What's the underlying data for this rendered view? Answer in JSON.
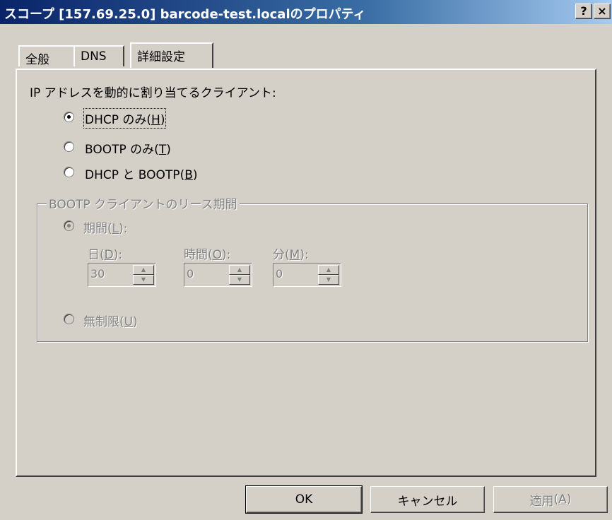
{
  "window": {
    "title": "スコープ [157.69.25.0] barcode-test.localのプロパティ",
    "help_button": "?",
    "close_button": "×"
  },
  "tabs": [
    {
      "label": "全般",
      "active": false
    },
    {
      "label": "DNS",
      "active": false
    },
    {
      "label": "詳細設定",
      "active": true
    }
  ],
  "section_label": "IP アドレスを動的に割り当てるクライアント:",
  "client_options": [
    {
      "text": "DHCP のみ",
      "mnemonic": "H",
      "checked": true
    },
    {
      "text": "BOOTP のみ",
      "mnemonic": "T",
      "checked": false
    },
    {
      "text": "DHCP と BOOTP",
      "mnemonic": "B",
      "checked": false
    }
  ],
  "lease_group": {
    "title": "BOOTP クライアントのリース期間",
    "limited": {
      "text": "期間",
      "mnemonic": "L",
      "checked": true
    },
    "days": {
      "label": "日",
      "mnemonic": "D",
      "value": "30"
    },
    "hours": {
      "label": "時間",
      "mnemonic": "O",
      "value": "0"
    },
    "minutes": {
      "label": "分",
      "mnemonic": "M",
      "value": "0"
    },
    "unlimited": {
      "text": "無制限",
      "mnemonic": "U",
      "checked": false
    }
  },
  "buttons": {
    "ok": "OK",
    "cancel": "キャンセル",
    "apply": {
      "text": "適用",
      "mnemonic": "A"
    }
  },
  "icons": {
    "radio-checked": "●",
    "spin-up": "▲",
    "spin-down": "▼"
  },
  "colors": {
    "dialog_bg": "#d4d0c8",
    "title_start": "#0a246a",
    "title_end": "#a6caf0",
    "disabled_text": "#808080"
  }
}
